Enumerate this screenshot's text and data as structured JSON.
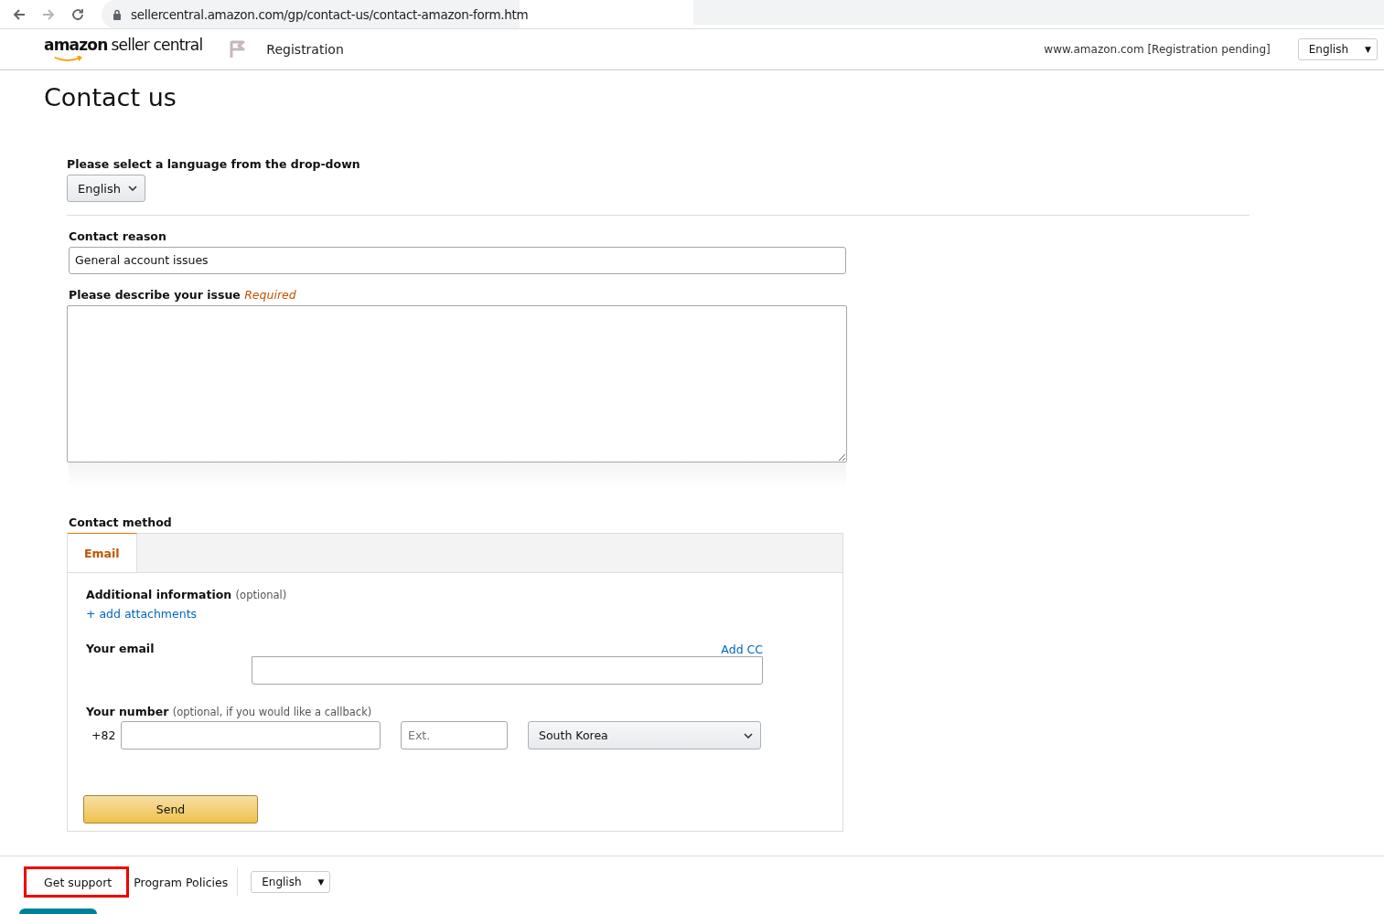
{
  "browser": {
    "url": "sellercentral.amazon.com/gp/contact-us/contact-amazon-form.htm"
  },
  "header": {
    "logo": {
      "brand": "amazon",
      "product": "seller central"
    },
    "section": "Registration",
    "account": "www.amazon.com [Registration pending]",
    "language": {
      "value": "English",
      "arrow": "▼"
    }
  },
  "page_title": "Contact us",
  "language_select": {
    "label": "Please select a language from the drop-down",
    "value": "English"
  },
  "contact_reason": {
    "label": "Contact reason",
    "value": "General account issues"
  },
  "issue": {
    "label": "Please describe your issue",
    "required": "Required"
  },
  "contact_method": {
    "label": "Contact method",
    "tabs": [
      {
        "label": "Email",
        "selected": true
      }
    ],
    "additional": {
      "label": "Additional information",
      "note": "(optional)",
      "link": "+ add attachments"
    },
    "email": {
      "label": "Your email",
      "add_cc": "Add CC"
    },
    "number": {
      "label": "Your number",
      "note": "(optional, if you would like a callback)",
      "prefix": "+82",
      "ext_placeholder": "Ext.",
      "country": "South Korea"
    },
    "send": "Send"
  },
  "footer": {
    "links": [
      {
        "label": "Get support",
        "highlighted": true
      },
      {
        "label": "Program Policies",
        "highlighted": false
      }
    ],
    "language": {
      "value": "English",
      "arrow": "▼"
    }
  }
}
